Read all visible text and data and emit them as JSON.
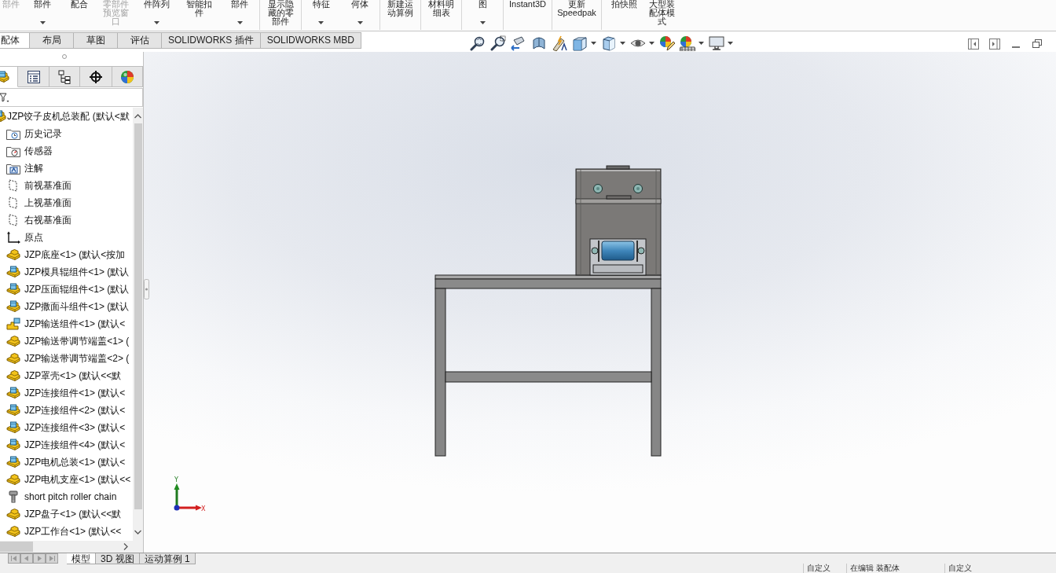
{
  "ribbon": {
    "groups": [
      {
        "buttons": [
          {
            "lines": [
              "部件"
            ],
            "disabled": true,
            "dropdown": false
          },
          {
            "lines": [
              "部件"
            ],
            "disabled": false,
            "dropdown": true
          },
          {
            "lines": [
              "配合"
            ],
            "disabled": false,
            "dropdown": false
          },
          {
            "lines": [
              "零部件",
              "预览窗",
              "口"
            ],
            "disabled": true,
            "dropdown": false
          },
          {
            "lines": [
              "件阵列"
            ],
            "disabled": false,
            "dropdown": true
          },
          {
            "lines": [
              "智能扣",
              "件"
            ],
            "disabled": false,
            "dropdown": false
          },
          {
            "lines": [
              "部件"
            ],
            "disabled": false,
            "dropdown": true
          }
        ]
      },
      {
        "buttons": [
          {
            "lines": [
              "显示隐",
              "藏的零",
              "部件"
            ],
            "disabled": false,
            "dropdown": false
          }
        ]
      },
      {
        "buttons": [
          {
            "lines": [
              "特征"
            ],
            "disabled": false,
            "dropdown": true
          },
          {
            "lines": [
              "何体"
            ],
            "disabled": false,
            "dropdown": true
          }
        ]
      },
      {
        "buttons": [
          {
            "lines": [
              "新建运",
              "动算例"
            ],
            "disabled": false,
            "dropdown": false
          }
        ]
      },
      {
        "buttons": [
          {
            "lines": [
              "材料明",
              "细表"
            ],
            "disabled": false,
            "dropdown": false
          }
        ]
      },
      {
        "buttons": [
          {
            "lines": [
              "图"
            ],
            "disabled": false,
            "dropdown": true
          }
        ]
      },
      {
        "buttons": [
          {
            "lines": [
              "Instant3D"
            ],
            "disabled": false,
            "dropdown": false
          }
        ]
      },
      {
        "buttons": [
          {
            "lines": [
              "更新",
              "Speedpak"
            ],
            "disabled": false,
            "dropdown": false
          }
        ]
      },
      {
        "buttons": [
          {
            "lines": [
              "拍快照"
            ],
            "disabled": false,
            "dropdown": false
          },
          {
            "lines": [
              "大型装",
              "配体模",
              "式"
            ],
            "disabled": false,
            "dropdown": false
          }
        ]
      }
    ]
  },
  "command_tabs": [
    {
      "label": "配体",
      "selected": true
    },
    {
      "label": "布局",
      "selected": false
    },
    {
      "label": "草图",
      "selected": false
    },
    {
      "label": "评估",
      "selected": false
    },
    {
      "label": "SOLIDWORKS 插件",
      "selected": false
    },
    {
      "label": "SOLIDWORKS MBD",
      "selected": false
    }
  ],
  "feature_panel": {
    "tabs": [
      {
        "selected": true
      },
      {
        "selected": false
      },
      {
        "selected": false
      },
      {
        "selected": false
      },
      {
        "selected": false
      }
    ],
    "tree": {
      "kind": "assembly",
      "label": "JZP饺子皮机总装配 (默认<默",
      "children": [
        {
          "kind": "history",
          "label": "历史记录"
        },
        {
          "kind": "sensor",
          "label": "传感器"
        },
        {
          "kind": "annotation",
          "label": "注解"
        },
        {
          "kind": "plane",
          "label": "前视基准面"
        },
        {
          "kind": "plane",
          "label": "上视基准面"
        },
        {
          "kind": "plane",
          "label": "右视基准面"
        },
        {
          "kind": "origin",
          "label": "原点"
        },
        {
          "kind": "part",
          "label": "JZP底座<1> (默认<按加"
        },
        {
          "kind": "assembly",
          "label": "JZP模具辊组件<1> (默认"
        },
        {
          "kind": "assembly",
          "label": "JZP压面辊组件<1> (默认"
        },
        {
          "kind": "assembly",
          "label": "JZP撒面斗组件<1> (默认"
        },
        {
          "kind": "flexible-assembly",
          "label": "JZP输送组件<1> (默认<"
        },
        {
          "kind": "part",
          "label": "JZP输送带调节端盖<1> ("
        },
        {
          "kind": "part",
          "label": "JZP输送带调节端盖<2> ("
        },
        {
          "kind": "part",
          "label": "JZP罩壳<1> (默认<<默"
        },
        {
          "kind": "assembly",
          "label": "JZP连接组件<1> (默认<"
        },
        {
          "kind": "assembly",
          "label": "JZP连接组件<2> (默认<"
        },
        {
          "kind": "assembly",
          "label": "JZP连接组件<3> (默认<"
        },
        {
          "kind": "assembly",
          "label": "JZP连接组件<4> (默认<"
        },
        {
          "kind": "assembly",
          "label": "JZP电机总装<1> (默认<"
        },
        {
          "kind": "part",
          "label": "JZP电机支座<1> (默认<<"
        },
        {
          "kind": "bolt",
          "label": "short pitch roller chain"
        },
        {
          "kind": "part",
          "label": "JZP盘子<1> (默认<<默"
        },
        {
          "kind": "part",
          "label": "JZP工作台<1> (默认<<"
        }
      ]
    }
  },
  "triad": {
    "y_label": "Y",
    "x_label": "X"
  },
  "bottom_tabs": [
    {
      "label": "模型",
      "selected": true
    },
    {
      "label": "3D 视图",
      "selected": false
    },
    {
      "label": "运动算例 1",
      "selected": false
    }
  ],
  "status_bar": {
    "fields": [
      "自定义",
      "在编辑 装配体",
      "自定义"
    ]
  }
}
